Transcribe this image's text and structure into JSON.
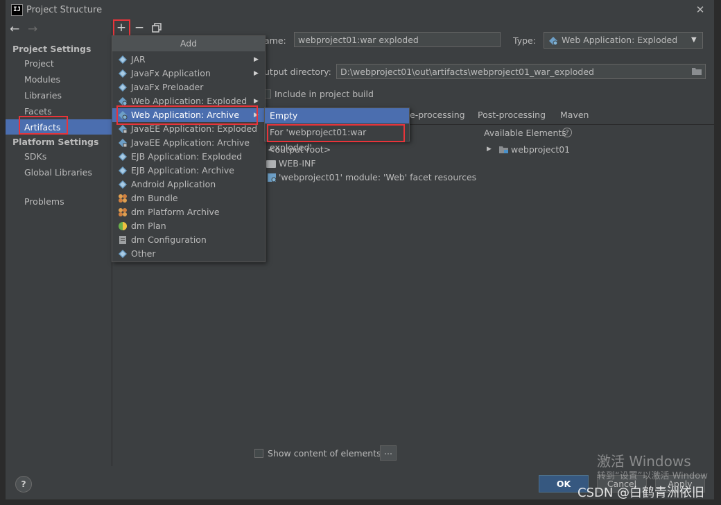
{
  "window": {
    "title": "Project Structure",
    "app_logo": "IJ"
  },
  "left_nav": {
    "back_icon": "arrow-left-icon",
    "forward_icon": "arrow-right-icon",
    "project_settings_header": "Project Settings",
    "project_settings_items": [
      "Project",
      "Modules",
      "Libraries",
      "Facets",
      "Artifacts"
    ],
    "platform_settings_header": "Platform Settings",
    "platform_settings_items": [
      "SDKs",
      "Global Libraries"
    ],
    "problems": "Problems"
  },
  "toolbar": {
    "add": "+",
    "remove": "−",
    "copy_icon": "copy-icon"
  },
  "add_menu": {
    "header": "Add",
    "items": [
      {
        "label": "JAR",
        "submenu": true
      },
      {
        "label": "JavaFx Application",
        "submenu": true
      },
      {
        "label": "JavaFx Preloader",
        "submenu": false
      },
      {
        "label": "Web Application: Exploded",
        "submenu": true
      },
      {
        "label": "Web Application: Archive",
        "submenu": true,
        "selected": true
      },
      {
        "label": "JavaEE Application: Exploded",
        "submenu": false
      },
      {
        "label": "JavaEE Application: Archive",
        "submenu": false
      },
      {
        "label": "EJB Application: Exploded",
        "submenu": false
      },
      {
        "label": "EJB Application: Archive",
        "submenu": false
      },
      {
        "label": "Android Application",
        "submenu": false
      },
      {
        "label": "dm Bundle",
        "submenu": false
      },
      {
        "label": "dm Platform Archive",
        "submenu": false
      },
      {
        "label": "dm Plan",
        "submenu": false
      },
      {
        "label": "dm Configuration",
        "submenu": false
      },
      {
        "label": "Other",
        "submenu": false
      }
    ]
  },
  "sub_menu": {
    "empty": "Empty",
    "for_item": "For 'webproject01:war exploded'"
  },
  "artifact": {
    "name_label": "ame:",
    "name_value": "webproject01:war exploded",
    "type_label": "Type:",
    "type_value": "Web Application: Exploded",
    "output_label": "utput directory:",
    "output_value": "D:\\webproject01\\out\\artifacts\\webproject01_war_exploded",
    "include_label": "Include in project build"
  },
  "tabs": [
    "e-processing",
    "Post-processing",
    "Maven"
  ],
  "layout_tree": {
    "root": "<output root>",
    "items": [
      "WEB-INF",
      "'webproject01' module: 'Web' facet resources"
    ]
  },
  "available": {
    "header": "Available Elements",
    "help": "?",
    "items": [
      "webproject01"
    ]
  },
  "bottom": {
    "show_content": "Show content of elements",
    "dots": "...",
    "ok": "OK",
    "cancel": "Cancel",
    "apply": "Apply",
    "help": "?"
  },
  "overlay": {
    "activate_title": "激活 Windows",
    "activate_sub": "转到“设置”以激活 Window",
    "csdn": "CSDN @白鹤青洲依旧"
  },
  "colors": {
    "selection": "#4b6eaf",
    "highlight_box": "#e8343a",
    "background": "#3c3f41",
    "ok_button": "#365880"
  }
}
